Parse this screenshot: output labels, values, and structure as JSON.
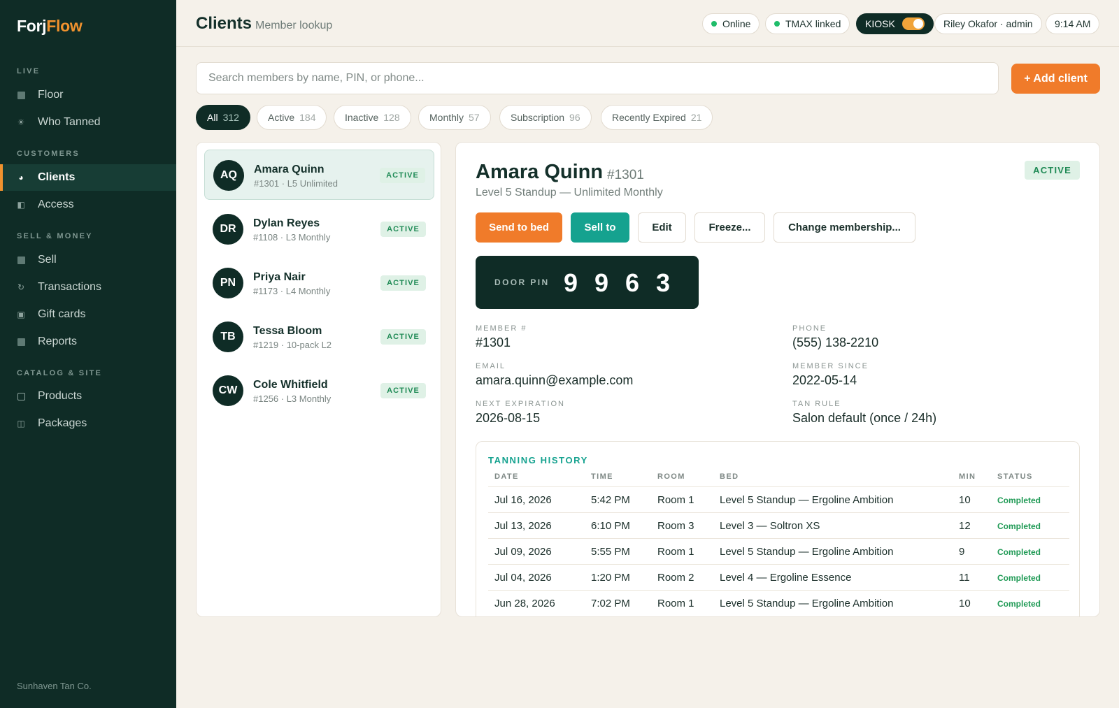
{
  "brand": {
    "part1": "Forj",
    "part2": "Flow"
  },
  "sidebar": {
    "sections": [
      {
        "label": "LIVE"
      },
      {
        "label": "CUSTOMERS"
      },
      {
        "label": "SELL & MONEY"
      },
      {
        "label": "CATALOG & SITE"
      }
    ],
    "items": [
      {
        "label": "Floor",
        "icon": "grid-icon"
      },
      {
        "label": "Who Tanned",
        "icon": "sun-icon"
      },
      {
        "label": "Clients",
        "icon": "pie-icon"
      },
      {
        "label": "Access",
        "icon": "door-icon"
      },
      {
        "label": "Sell",
        "icon": "register-icon"
      },
      {
        "label": "Transactions",
        "icon": "refresh-icon"
      },
      {
        "label": "Gift cards",
        "icon": "gift-card-icon"
      },
      {
        "label": "Reports",
        "icon": "report-icon"
      },
      {
        "label": "Products",
        "icon": "box-icon"
      },
      {
        "label": "Packages",
        "icon": "package-icon"
      }
    ],
    "footer": "Sunhaven Tan Co."
  },
  "header": {
    "title": "Clients",
    "subtitle": "Member lookup",
    "status_online": "Online",
    "status_tmax": "TMAX linked",
    "kiosk_label": "KIOSK",
    "user": "Riley Okafor · admin",
    "time": "9:14 AM"
  },
  "search": {
    "placeholder": "Search members by name, PIN, or phone..."
  },
  "add_client_label": "+ Add client",
  "filters": [
    {
      "label": "All",
      "count": "312"
    },
    {
      "label": "Active",
      "count": "184"
    },
    {
      "label": "Inactive",
      "count": "128"
    },
    {
      "label": "Monthly",
      "count": "57"
    },
    {
      "label": "Subscription",
      "count": "96"
    },
    {
      "label": "Recently Expired",
      "count": "21"
    }
  ],
  "clients": [
    {
      "initials": "AQ",
      "name": "Amara Quinn",
      "meta": "#1301 · L5 Unlimited",
      "status": "ACTIVE"
    },
    {
      "initials": "DR",
      "name": "Dylan Reyes",
      "meta": "#1108 · L3 Monthly",
      "status": "ACTIVE"
    },
    {
      "initials": "PN",
      "name": "Priya Nair",
      "meta": "#1173 · L4 Monthly",
      "status": "ACTIVE"
    },
    {
      "initials": "TB",
      "name": "Tessa Bloom",
      "meta": "#1219 · 10-pack L2",
      "status": "ACTIVE"
    },
    {
      "initials": "CW",
      "name": "Cole Whitfield",
      "meta": "#1256 · L3 Monthly",
      "status": "ACTIVE"
    }
  ],
  "detail": {
    "name": "Amara Quinn",
    "number": "#1301",
    "plan": "Level 5 Standup — Unlimited Monthly",
    "status": "ACTIVE",
    "actions": {
      "send_to_bed": "Send to bed",
      "sell_to": "Sell to",
      "edit": "Edit",
      "freeze": "Freeze...",
      "change_membership": "Change membership..."
    },
    "door_pin_label": "DOOR PIN",
    "door_pin_digits": [
      "9",
      "9",
      "6",
      "3"
    ],
    "fields": {
      "member_label": "MEMBER #",
      "member_value": "#1301",
      "phone_label": "PHONE",
      "phone_value": "(555) 138-2210",
      "email_label": "EMAIL",
      "email_value": "amara.quinn@example.com",
      "since_label": "MEMBER SINCE",
      "since_value": "2022-05-14",
      "expiration_label": "NEXT EXPIRATION",
      "expiration_value": "2026-08-15",
      "tan_rule_label": "TAN RULE",
      "tan_rule_value": "Salon default (once / 24h)"
    },
    "history": {
      "title": "TANNING HISTORY",
      "columns": [
        "DATE",
        "TIME",
        "ROOM",
        "BED",
        "MIN",
        "STATUS"
      ],
      "rows": [
        [
          "Jul 16, 2026",
          "5:42 PM",
          "Room 1",
          "Level 5 Standup — Ergoline Ambition",
          "10",
          "Completed"
        ],
        [
          "Jul 13, 2026",
          "6:10 PM",
          "Room 3",
          "Level 3 — Soltron XS",
          "12",
          "Completed"
        ],
        [
          "Jul 09, 2026",
          "5:55 PM",
          "Room 1",
          "Level 5 Standup — Ergoline Ambition",
          "9",
          "Completed"
        ],
        [
          "Jul 04, 2026",
          "1:20 PM",
          "Room 2",
          "Level 4 — Ergoline Essence",
          "11",
          "Completed"
        ],
        [
          "Jun 28, 2026",
          "7:02 PM",
          "Room 1",
          "Level 5 Standup — Ergoline Ambition",
          "10",
          "Completed"
        ]
      ]
    }
  },
  "colors": {
    "sidebar_bg": "#0f2c26",
    "accent_orange": "#f07b2a",
    "accent_teal": "#15a28f",
    "status_green": "#1f8a55",
    "page_bg": "#f5f1ea"
  }
}
